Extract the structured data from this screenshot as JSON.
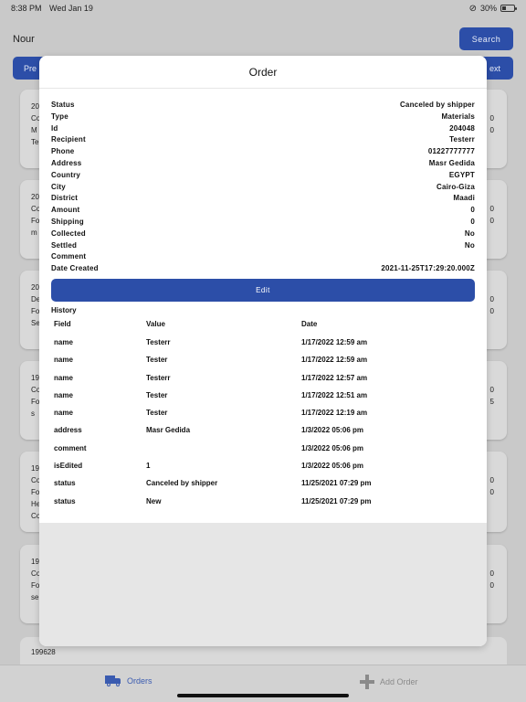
{
  "status_bar": {
    "time": "8:38 PM",
    "date": "Wed Jan 19",
    "battery": "30%"
  },
  "background": {
    "user": "Nour",
    "search_label": "Search",
    "prev_label": "Pre",
    "next_label": "ext",
    "cards": [
      {
        "left": [
          "20",
          "Co",
          "M",
          "Te"
        ],
        "right": [
          "0",
          "0"
        ]
      },
      {
        "left": [
          "20",
          "Co",
          "Fo",
          "m"
        ],
        "right": [
          "0",
          "0"
        ]
      },
      {
        "left": [
          "20",
          "De",
          "Fo",
          "Se"
        ],
        "right": [
          "0",
          "0"
        ]
      },
      {
        "left": [
          "19",
          "Co",
          "Fo",
          "s"
        ],
        "right": [
          "0",
          "5"
        ]
      },
      {
        "left": [
          "19",
          "Co",
          "Fo",
          "He",
          "Co"
        ],
        "right": [
          "0",
          "0"
        ]
      },
      {
        "left": [
          "19",
          "Co",
          "Fo",
          "se"
        ],
        "right": [
          "0",
          "0"
        ]
      }
    ],
    "bottom_card_number": "199628"
  },
  "modal": {
    "title": "Order",
    "details": [
      {
        "key": "Status",
        "value": "Canceled by shipper"
      },
      {
        "key": "Type",
        "value": "Materials"
      },
      {
        "key": "Id",
        "value": "204048"
      },
      {
        "key": "Recipient",
        "value": "Testerr"
      },
      {
        "key": "Phone",
        "value": "01227777777"
      },
      {
        "key": "Address",
        "value": "Masr Gedida"
      },
      {
        "key": "Country",
        "value": "EGYPT"
      },
      {
        "key": "City",
        "value": "Cairo-Giza"
      },
      {
        "key": "District",
        "value": "Maadi"
      },
      {
        "key": "Amount",
        "value": "0"
      },
      {
        "key": "Shipping",
        "value": "0"
      },
      {
        "key": "Collected",
        "value": "No"
      },
      {
        "key": "Settled",
        "value": "No"
      },
      {
        "key": "Comment",
        "value": ""
      },
      {
        "key": "Date Created",
        "value": "2021-11-25T17:29:20.000Z"
      }
    ],
    "edit_label": "Edit",
    "history_title": "History",
    "history_headers": {
      "field": "Field",
      "value": "Value",
      "date": "Date"
    },
    "history": [
      {
        "field": "name",
        "value": "Testerr",
        "date": "1/17/2022 12:59 am"
      },
      {
        "field": "name",
        "value": "Tester",
        "date": "1/17/2022 12:59 am"
      },
      {
        "field": "name",
        "value": "Testerr",
        "date": "1/17/2022 12:57 am"
      },
      {
        "field": "name",
        "value": "Tester",
        "date": "1/17/2022 12:51 am"
      },
      {
        "field": "name",
        "value": "Tester",
        "date": "1/17/2022 12:19 am"
      },
      {
        "field": "address",
        "value": "Masr Gedida",
        "date": "1/3/2022 05:06 pm"
      },
      {
        "field": "comment",
        "value": "",
        "date": "1/3/2022 05:06 pm"
      },
      {
        "field": "isEdited",
        "value": "1",
        "date": "1/3/2022 05:06 pm"
      },
      {
        "field": "status",
        "value": "Canceled by shipper",
        "date": "11/25/2021 07:29 pm"
      },
      {
        "field": "status",
        "value": "New",
        "date": "11/25/2021 07:29 pm"
      }
    ]
  },
  "tabs": {
    "orders_label": "Orders",
    "add_order_label": "Add Order"
  },
  "colors": {
    "accent": "#2c4ea8",
    "tab_active": "#3a5bb0",
    "tab_inactive": "#8a8a8a"
  }
}
